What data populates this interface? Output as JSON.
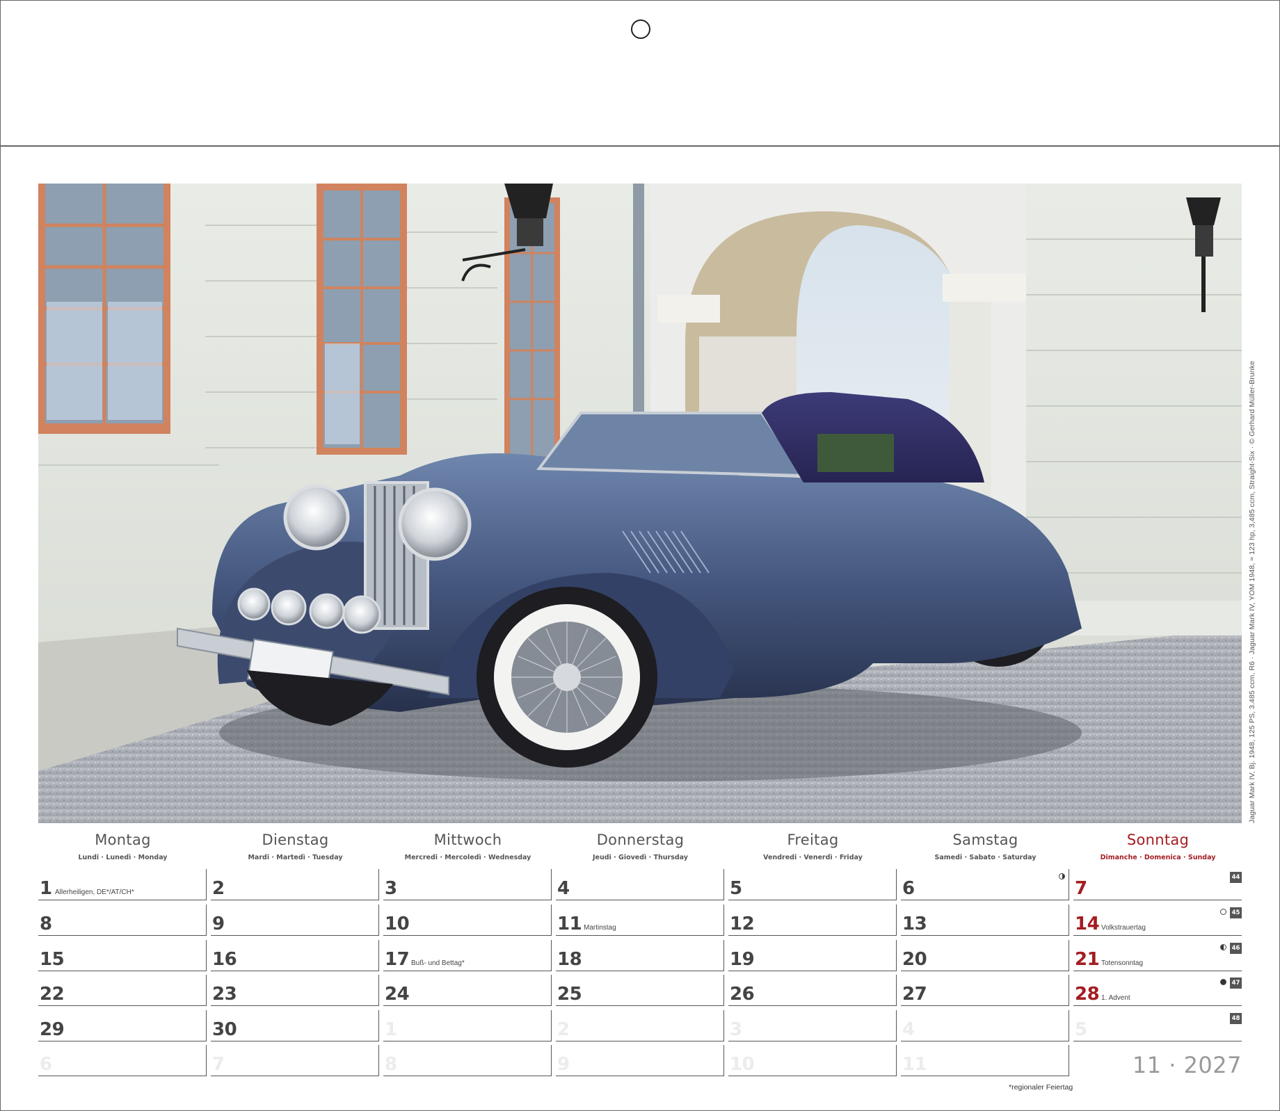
{
  "photo": {
    "subject": "classic-car",
    "credit": "Jaguar Mark IV, Bj. 1948, 125 PS, 3.485 ccm, R6 · Jaguar Mark IV, YOM 1948, ≈ 123 hp, 3,485 ccm, Straight-Six · © Gerhard Müller-Brunke"
  },
  "weekdays": [
    {
      "name": "Montag",
      "sub": "Lundi · Lunedì · Monday"
    },
    {
      "name": "Dienstag",
      "sub": "Mardi · Martedì · Tuesday"
    },
    {
      "name": "Mittwoch",
      "sub": "Mercredi · Mercoledì · Wednesday"
    },
    {
      "name": "Donnerstag",
      "sub": "Jeudi · Giovedì · Thursday"
    },
    {
      "name": "Freitag",
      "sub": "Vendredi · Venerdì · Friday"
    },
    {
      "name": "Samstag",
      "sub": "Samedi · Sabato · Saturday"
    },
    {
      "name": "Sonntag",
      "sub": "Dimanche · Domenica · Sunday"
    }
  ],
  "weeks": [
    {
      "week_number": "44",
      "moon": "first-quarter",
      "moon_day_index": 5,
      "days": [
        {
          "num": "1",
          "note": "Allerheiligen, DE*/AT/CH*",
          "muted": false
        },
        {
          "num": "2",
          "note": "",
          "muted": false
        },
        {
          "num": "3",
          "note": "",
          "muted": false
        },
        {
          "num": "4",
          "note": "",
          "muted": false
        },
        {
          "num": "5",
          "note": "",
          "muted": false
        },
        {
          "num": "6",
          "note": "",
          "muted": false
        },
        {
          "num": "7",
          "note": "",
          "muted": false
        }
      ]
    },
    {
      "week_number": "45",
      "moon": "full",
      "moon_day_index": 6,
      "days": [
        {
          "num": "8",
          "note": "",
          "muted": false
        },
        {
          "num": "9",
          "note": "",
          "muted": false
        },
        {
          "num": "10",
          "note": "",
          "muted": false
        },
        {
          "num": "11",
          "note": "Martinstag",
          "muted": false
        },
        {
          "num": "12",
          "note": "",
          "muted": false
        },
        {
          "num": "13",
          "note": "",
          "muted": false
        },
        {
          "num": "14",
          "note": "Volkstrauertag",
          "muted": false
        }
      ]
    },
    {
      "week_number": "46",
      "moon": "last-quarter",
      "moon_day_index": 6,
      "days": [
        {
          "num": "15",
          "note": "",
          "muted": false
        },
        {
          "num": "16",
          "note": "",
          "muted": false
        },
        {
          "num": "17",
          "note": "Buß- und Bettag*",
          "muted": false
        },
        {
          "num": "18",
          "note": "",
          "muted": false
        },
        {
          "num": "19",
          "note": "",
          "muted": false
        },
        {
          "num": "20",
          "note": "",
          "muted": false
        },
        {
          "num": "21",
          "note": "Totensonntag",
          "muted": false
        }
      ]
    },
    {
      "week_number": "47",
      "moon": "new",
      "moon_day_index": 6,
      "days": [
        {
          "num": "22",
          "note": "",
          "muted": false
        },
        {
          "num": "23",
          "note": "",
          "muted": false
        },
        {
          "num": "24",
          "note": "",
          "muted": false
        },
        {
          "num": "25",
          "note": "",
          "muted": false
        },
        {
          "num": "26",
          "note": "",
          "muted": false
        },
        {
          "num": "27",
          "note": "",
          "muted": false
        },
        {
          "num": "28",
          "note": "1. Advent",
          "muted": false
        }
      ]
    },
    {
      "week_number": "48",
      "moon": "",
      "moon_day_index": -1,
      "days": [
        {
          "num": "29",
          "note": "",
          "muted": false
        },
        {
          "num": "30",
          "note": "",
          "muted": false
        },
        {
          "num": "1",
          "note": "",
          "muted": true
        },
        {
          "num": "2",
          "note": "",
          "muted": true
        },
        {
          "num": "3",
          "note": "",
          "muted": true
        },
        {
          "num": "4",
          "note": "",
          "muted": true
        },
        {
          "num": "5",
          "note": "",
          "muted": true
        }
      ]
    },
    {
      "week_number": "",
      "moon": "",
      "moon_day_index": -1,
      "days": [
        {
          "num": "6",
          "note": "",
          "muted": true
        },
        {
          "num": "7",
          "note": "",
          "muted": true
        },
        {
          "num": "8",
          "note": "",
          "muted": true
        },
        {
          "num": "9",
          "note": "",
          "muted": true
        },
        {
          "num": "10",
          "note": "",
          "muted": true
        },
        {
          "num": "11",
          "note": "",
          "muted": true
        }
      ]
    }
  ],
  "month_year": "11 · 2027",
  "footnote": "*regionaler Feiertag",
  "colors": {
    "sunday_red": "#a31d22",
    "text_gray": "#444444",
    "muted_gray": "#ececec",
    "badge_gray": "#555555"
  }
}
